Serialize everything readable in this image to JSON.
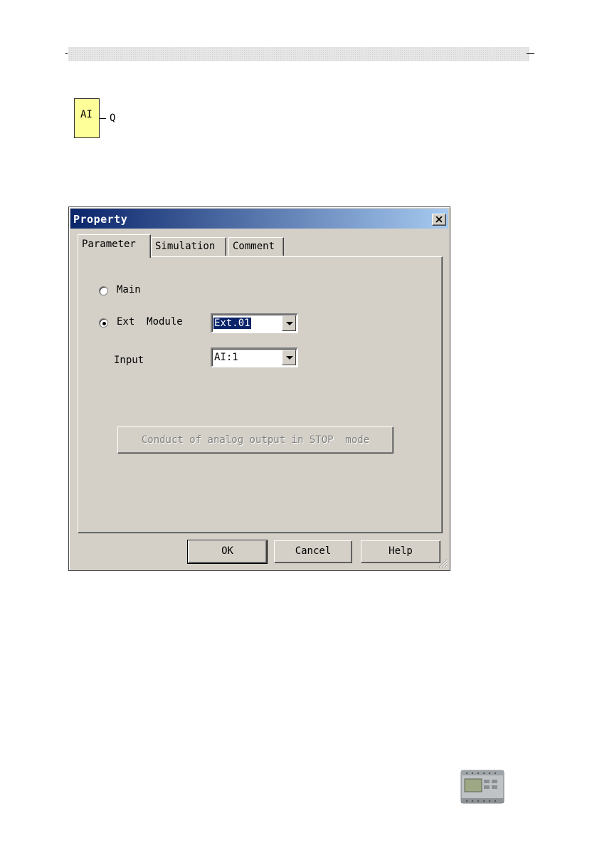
{
  "function_block": {
    "label": "AI",
    "output": "Q",
    "color": "#ffff99"
  },
  "dialog": {
    "title": "Property",
    "close_icon": "close-icon",
    "tabs": [
      {
        "label": "Parameter",
        "active": true
      },
      {
        "label": "Simulation",
        "active": false
      },
      {
        "label": "Comment",
        "active": false
      }
    ],
    "main_option": {
      "label": "Main",
      "selected": false
    },
    "ext_option": {
      "label": "Ext  Module",
      "selected": true
    },
    "ext_module": {
      "value": "Ext.01"
    },
    "input": {
      "label": "Input",
      "value": "AI:1"
    },
    "analog_button": "Conduct of analog output in STOP  mode",
    "buttons": {
      "ok": "OK",
      "cancel": "Cancel",
      "help": "Help"
    },
    "titlebar_colors": [
      "#0a246a",
      "#a6caf0"
    ],
    "face_color": "#d4d0c8"
  }
}
